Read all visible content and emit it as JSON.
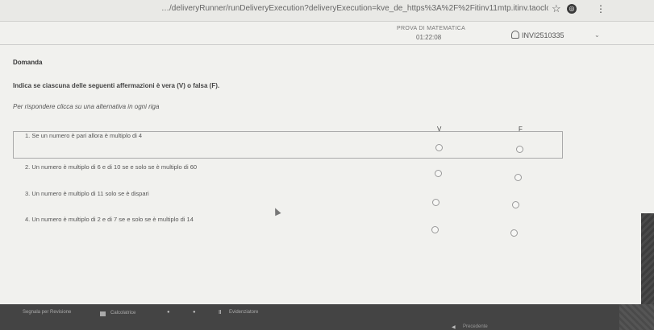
{
  "browser": {
    "url": "…/deliveryRunner/runDeliveryExecution?deliveryExecution=kve_de_https%3A%2F%2Fitinv11mtp.itinv.taocloud.org%2F%…",
    "icons": [
      "star-icon",
      "extension-icon",
      "menu-icon"
    ]
  },
  "test": {
    "title": "PROVA DI MATEMATICA",
    "timer": "01:22:08",
    "user_id": "INVI2510335"
  },
  "question": {
    "label": "Domanda",
    "instructions": "Indica se ciascuna delle seguenti affermazioni è vera (V) o falsa (F).",
    "hint": "Per rispondere clicca su una alternativa in ogni riga",
    "col_true": "V",
    "col_false": "F",
    "statements": [
      "1. Se un numero è pari allora è multiplo di 4",
      "2. Un numero è multiplo di 6 e di 10 se e solo se è multiplo di 60",
      "3. Un numero è multiplo di 11 solo se è dispari",
      "4. Un numero è multiplo di 2 e di 7 se e solo se è multiplo di 14"
    ]
  },
  "toolbar": {
    "left_label": "Segnala per Revisione",
    "calc_label": "Calcolatrice",
    "marker_label": "Evidenziatore",
    "nav_label": "Precedente"
  }
}
